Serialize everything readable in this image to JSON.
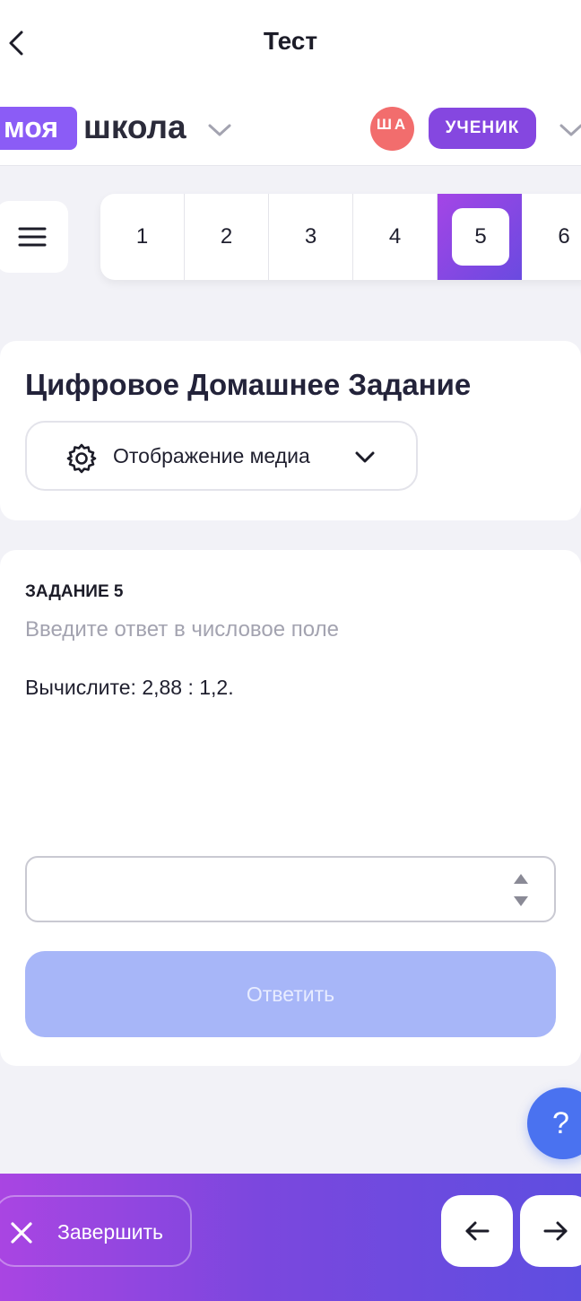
{
  "header": {
    "title": "Тест",
    "brand_part1": "моя",
    "brand_part2": "школа",
    "avatar_initials": "ША",
    "role": "УЧЕНИК"
  },
  "question_nav": {
    "items": [
      "1",
      "2",
      "3",
      "4",
      "5",
      "6"
    ],
    "active": "5"
  },
  "homework": {
    "title": "Цифровое Домашнее Задание",
    "media_dropdown": "Отображение медиа"
  },
  "task": {
    "label": "ЗАДАНИЕ 5",
    "hint": "Введите ответ в числовое поле",
    "text": "Вычислите: 2,88 : 1,2.",
    "answer_value": "",
    "submit_label": "Ответить"
  },
  "help": {
    "label": "?"
  },
  "footer": {
    "finish_label": "Завершить"
  },
  "colors": {
    "brand_purple": "#8b5cf6",
    "avatar": "#f26d6d",
    "role_badge": "#8547e0",
    "submit_disabled": "#a7b6f8",
    "help_button": "#4a72f0"
  }
}
